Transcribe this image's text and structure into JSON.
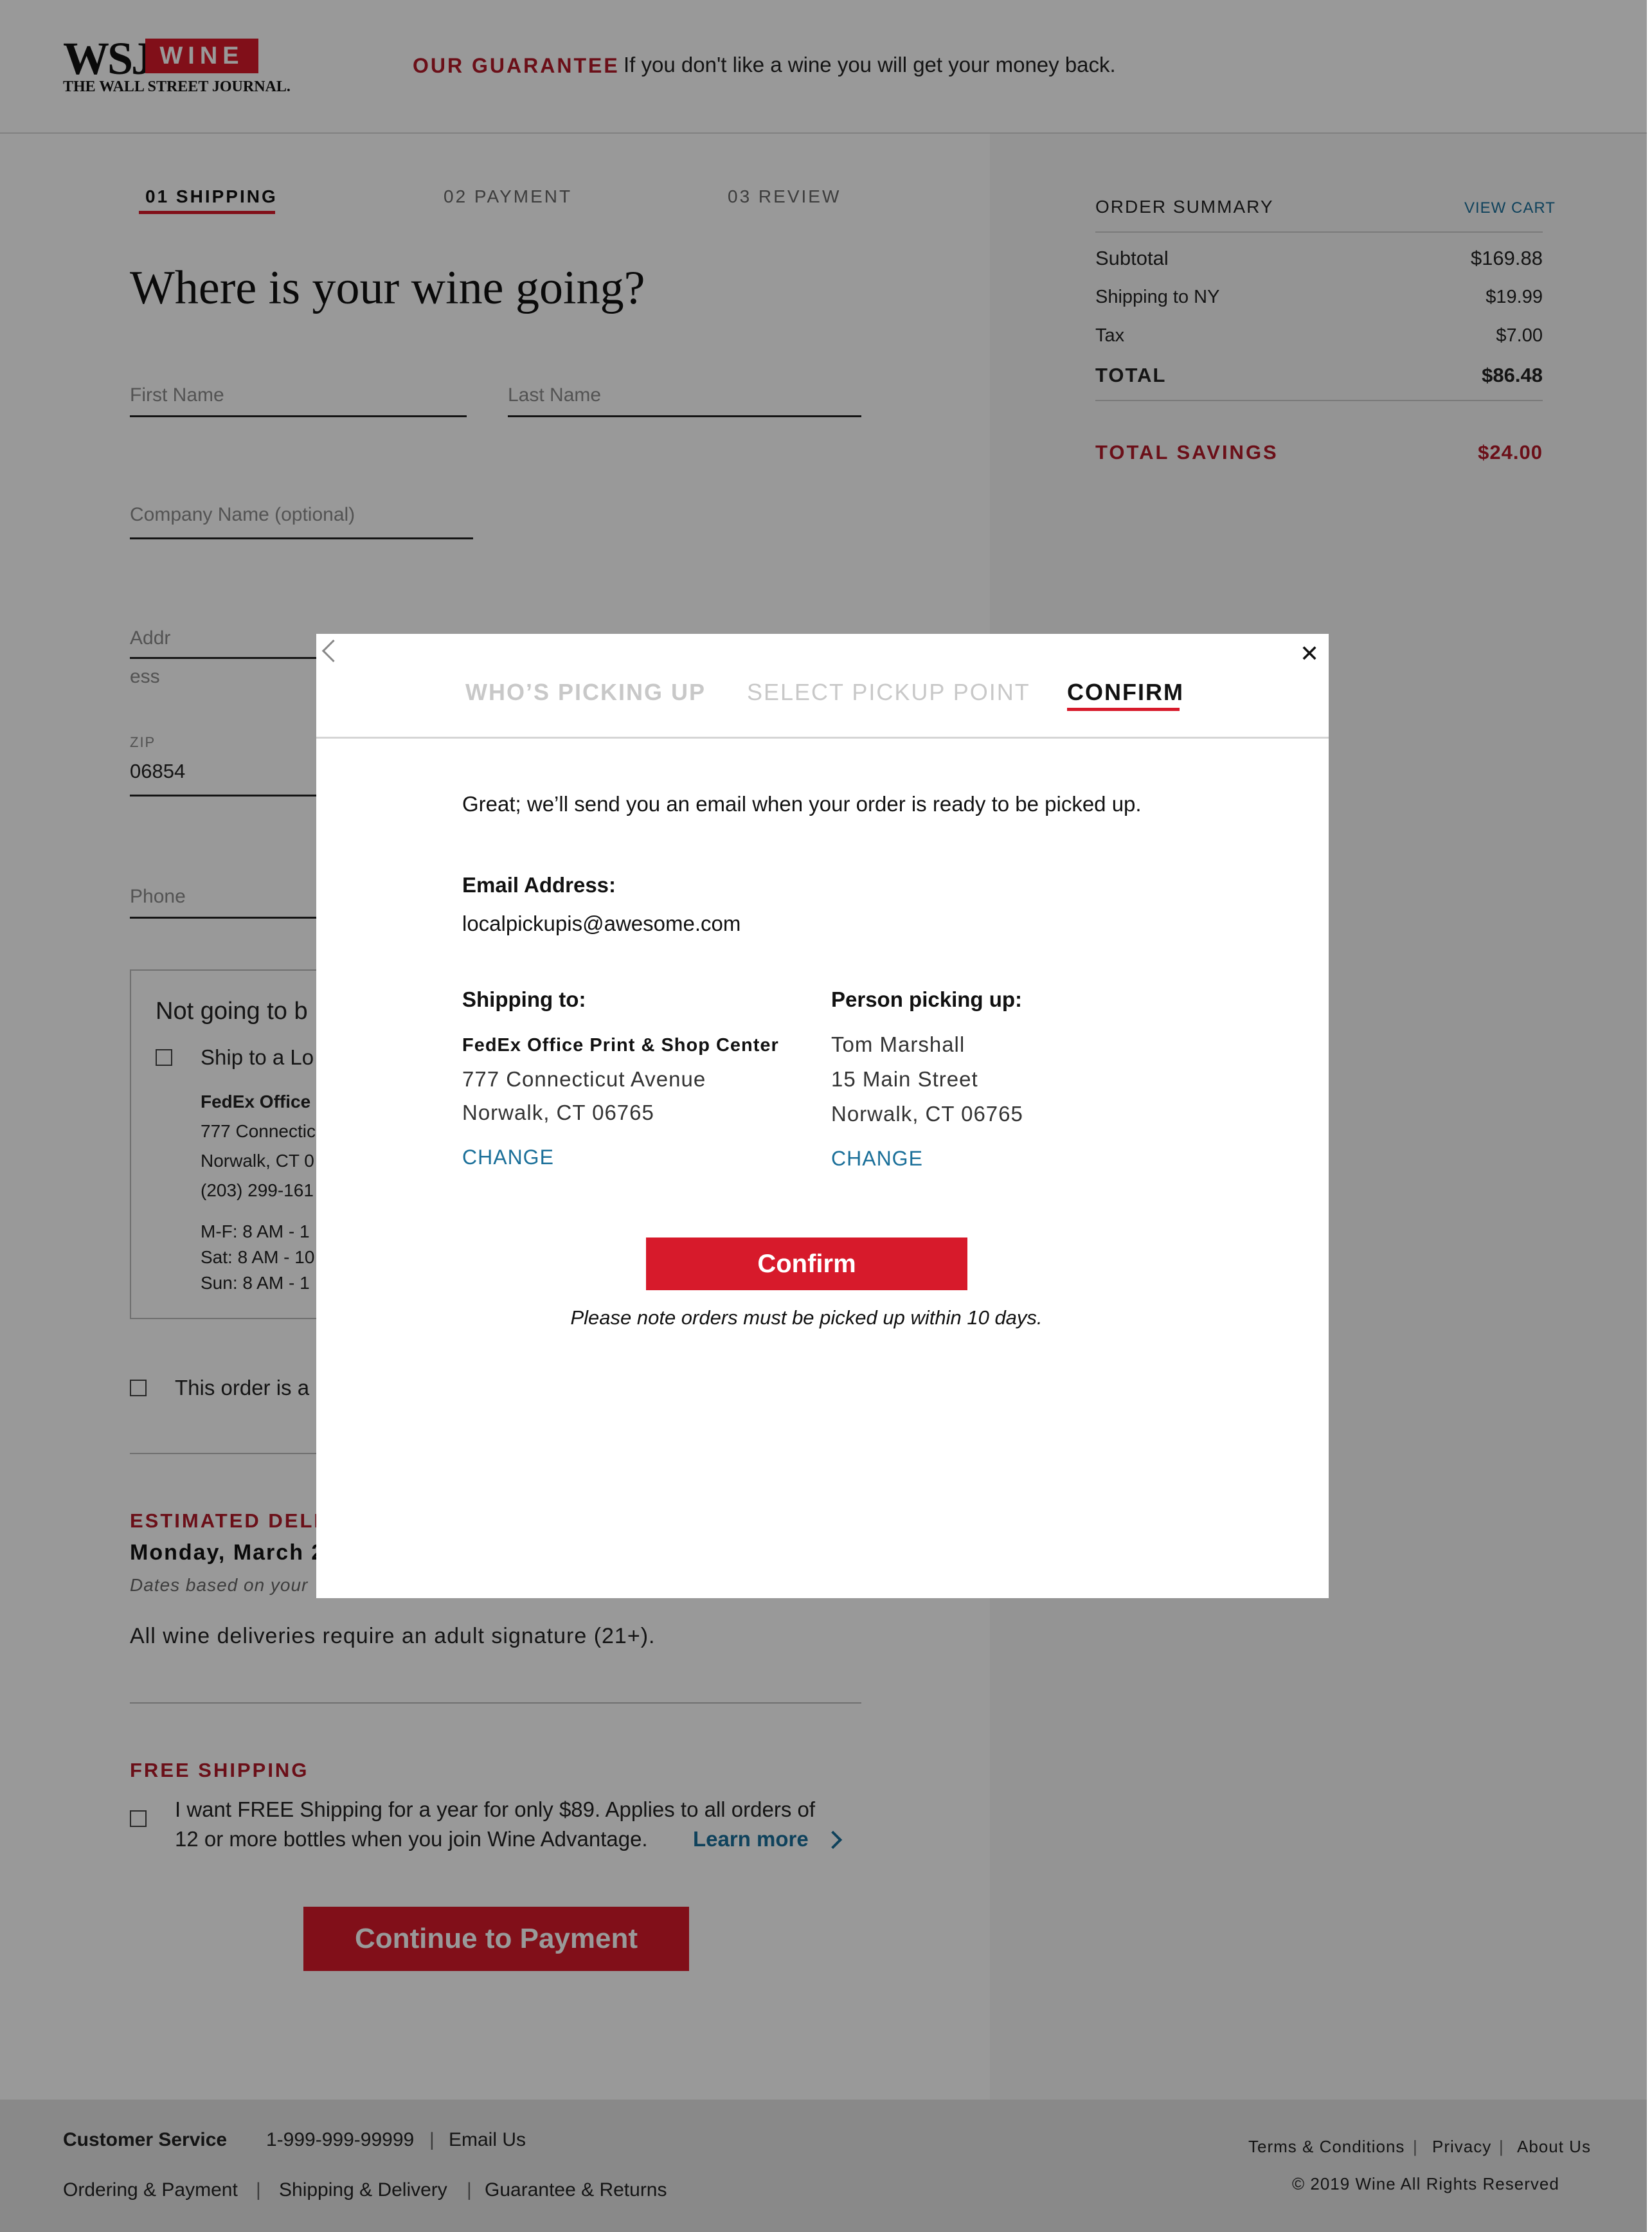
{
  "header": {
    "logo_wsj": "WSJ",
    "logo_wine": "WINE",
    "logo_sub": "THE WALL STREET JOURNAL.",
    "guarantee_label": "OUR GUARANTEE",
    "guarantee_text": "If you don't like a wine you will get your money back."
  },
  "steps": [
    {
      "label": "01 SHIPPING",
      "active": true
    },
    {
      "label": "02 PAYMENT",
      "active": false
    },
    {
      "label": "03 REVIEW",
      "active": false
    }
  ],
  "form": {
    "title": "Where is your wine going?",
    "first_name_placeholder": "First Name",
    "last_name_placeholder": "Last Name",
    "company_placeholder": "Company Name  (optional)",
    "address_placeholder_1": "Addr",
    "address_placeholder_2": "ess",
    "zip_label": "ZIP",
    "zip_value": "06854",
    "phone_placeholder": "Phone"
  },
  "pickup_box": {
    "heading": "Not going to b",
    "ship_label": "Ship to a Lo",
    "store_name": "FedEx Office",
    "address_1": "777 Connectic",
    "address_2": "Norwalk, CT 0",
    "phone": "(203) 299-161",
    "hours_1": "M-F:  8 AM - 1",
    "hours_2": "Sat:  8 AM - 10",
    "hours_3": "Sun:  8 AM - 1"
  },
  "gift_label": "This order is a",
  "delivery": {
    "heading": "ESTIMATED DELIV",
    "date": "Monday, March 2",
    "note": "Dates based on your",
    "signature": "All wine deliveries require an adult signature (21+)."
  },
  "free_shipping": {
    "heading": "FREE SHIPPING",
    "line1": "I want FREE Shipping for a year for only $89.  Applies to all orders of",
    "line2": "12 or more bottles when you join Wine Advantage.",
    "learn_more": "Learn more"
  },
  "continue_label": "Continue to Payment",
  "summary": {
    "title": "ORDER SUMMARY",
    "view_cart": "VIEW CART",
    "rows": [
      {
        "label": "Subtotal",
        "value": "$169.88"
      },
      {
        "label": "Shipping to NY",
        "value": "$19.99"
      },
      {
        "label": "Tax",
        "value": "$7.00"
      }
    ],
    "total_label": "TOTAL",
    "total_value": "$86.48",
    "savings_label": "TOTAL SAVINGS",
    "savings_value": "$24.00"
  },
  "footer": {
    "cs_label": "Customer Service",
    "phone": "1-999-999-99999",
    "sep": "|",
    "email": "Email Us",
    "link_1": "Ordering & Payment",
    "link_2": "Shipping & Delivery",
    "link_3": "Guarantee & Returns",
    "terms": "Terms & Conditions",
    "privacy": "Privacy",
    "about": "About Us",
    "copyright": "©  2019 Wine All Rights Reserved"
  },
  "modal": {
    "tab_1": "WHO’S PICKING UP",
    "tab_2": "SELECT PICKUP POINT",
    "tab_3": "CONFIRM",
    "close": "✕",
    "message": "Great; we’ll send you an email when your order is ready to be picked up.",
    "email_label": "Email Address:",
    "email_value": "localpickupis@awesome.com",
    "ship_label": "Shipping to:",
    "ship_name": "FedEx Office Print & Shop Center",
    "ship_addr_1": "777 Connecticut Avenue",
    "ship_addr_2": "Norwalk, CT 06765",
    "change_1": "CHANGE",
    "person_label": "Person picking up:",
    "person_name": "Tom Marshall",
    "person_addr_1": "15 Main Street",
    "person_addr_2": "Norwalk, CT 06765",
    "change_2": "CHANGE",
    "confirm_label": "Confirm",
    "note": "Please note orders must be picked up within 10 days."
  }
}
